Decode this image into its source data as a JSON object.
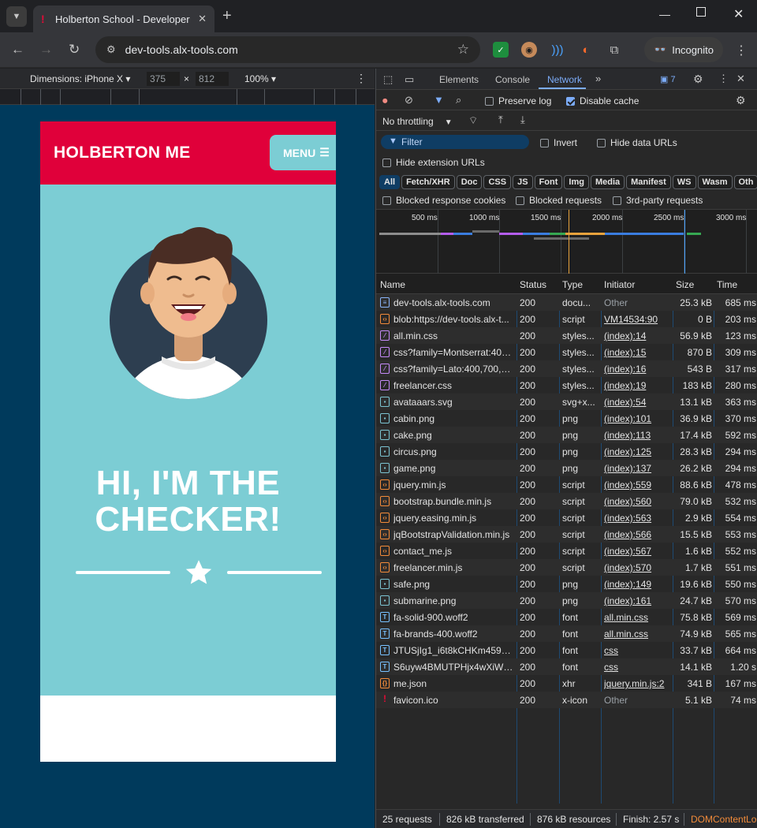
{
  "browser": {
    "tab_title": "Holberton School - Developer t",
    "url": "dev-tools.alx-tools.com",
    "incognito_label": "Incognito"
  },
  "device_toolbar": {
    "dimensions_label": "Dimensions: iPhone X",
    "width": "375",
    "height": "812",
    "times": "×",
    "zoom": "100%"
  },
  "site": {
    "brand": "HOLBERTON ME",
    "menu_label": "MENU",
    "hero_line1": "HI, I'M THE",
    "hero_line2": "CHECKER!"
  },
  "devtools": {
    "tabs": [
      "Elements",
      "Console",
      "Network"
    ],
    "active_tab": "Network",
    "issues_count": "7",
    "preserve_log": "Preserve log",
    "disable_cache": "Disable cache",
    "throttling": "No throttling",
    "filter_placeholder": "Filter",
    "invert": "Invert",
    "hide_data_urls": "Hide data URLs",
    "hide_extension_urls": "Hide extension URLs",
    "type_filters": [
      "All",
      "Fetch/XHR",
      "Doc",
      "CSS",
      "JS",
      "Font",
      "Img",
      "Media",
      "Manifest",
      "WS",
      "Wasm",
      "Oth"
    ],
    "blocked_response_cookies": "Blocked response cookies",
    "blocked_requests": "Blocked requests",
    "third_party_requests": "3rd-party requests",
    "timeline_labels": [
      "500 ms",
      "1000 ms",
      "1500 ms",
      "2000 ms",
      "2500 ms",
      "3000 ms"
    ],
    "columns": {
      "name": "Name",
      "status": "Status",
      "type": "Type",
      "initiator": "Initiator",
      "size": "Size",
      "time": "Time"
    },
    "requests": [
      {
        "name": "dev-tools.alx-tools.com",
        "status": "200",
        "type": "docu...",
        "initiator": "Other",
        "size": "25.3 kB",
        "time": "685 ms",
        "kind": "doc"
      },
      {
        "name": "blob:https://dev-tools.alx-t...",
        "status": "200",
        "type": "script",
        "initiator": "VM14534:90",
        "size": "0 B",
        "time": "203 ms",
        "kind": "js"
      },
      {
        "name": "all.min.css",
        "status": "200",
        "type": "styles...",
        "initiator": "(index):14",
        "size": "56.9 kB",
        "time": "123 ms",
        "kind": "css"
      },
      {
        "name": "css?family=Montserrat:400...",
        "status": "200",
        "type": "styles...",
        "initiator": "(index):15",
        "size": "870 B",
        "time": "309 ms",
        "kind": "css"
      },
      {
        "name": "css?family=Lato:400,700,4...",
        "status": "200",
        "type": "styles...",
        "initiator": "(index):16",
        "size": "543 B",
        "time": "317 ms",
        "kind": "css"
      },
      {
        "name": "freelancer.css",
        "status": "200",
        "type": "styles...",
        "initiator": "(index):19",
        "size": "183 kB",
        "time": "280 ms",
        "kind": "css"
      },
      {
        "name": "avataaars.svg",
        "status": "200",
        "type": "svg+x...",
        "initiator": "(index):54",
        "size": "13.1 kB",
        "time": "363 ms",
        "kind": "img"
      },
      {
        "name": "cabin.png",
        "status": "200",
        "type": "png",
        "initiator": "(index):101",
        "size": "36.9 kB",
        "time": "370 ms",
        "kind": "img"
      },
      {
        "name": "cake.png",
        "status": "200",
        "type": "png",
        "initiator": "(index):113",
        "size": "17.4 kB",
        "time": "592 ms",
        "kind": "img"
      },
      {
        "name": "circus.png",
        "status": "200",
        "type": "png",
        "initiator": "(index):125",
        "size": "28.3 kB",
        "time": "294 ms",
        "kind": "img"
      },
      {
        "name": "game.png",
        "status": "200",
        "type": "png",
        "initiator": "(index):137",
        "size": "26.2 kB",
        "time": "294 ms",
        "kind": "img"
      },
      {
        "name": "jquery.min.js",
        "status": "200",
        "type": "script",
        "initiator": "(index):559",
        "size": "88.6 kB",
        "time": "478 ms",
        "kind": "js"
      },
      {
        "name": "bootstrap.bundle.min.js",
        "status": "200",
        "type": "script",
        "initiator": "(index):560",
        "size": "79.0 kB",
        "time": "532 ms",
        "kind": "js"
      },
      {
        "name": "jquery.easing.min.js",
        "status": "200",
        "type": "script",
        "initiator": "(index):563",
        "size": "2.9 kB",
        "time": "554 ms",
        "kind": "js"
      },
      {
        "name": "jqBootstrapValidation.min.js",
        "status": "200",
        "type": "script",
        "initiator": "(index):566",
        "size": "15.5 kB",
        "time": "553 ms",
        "kind": "js"
      },
      {
        "name": "contact_me.js",
        "status": "200",
        "type": "script",
        "initiator": "(index):567",
        "size": "1.6 kB",
        "time": "552 ms",
        "kind": "js"
      },
      {
        "name": "freelancer.min.js",
        "status": "200",
        "type": "script",
        "initiator": "(index):570",
        "size": "1.7 kB",
        "time": "551 ms",
        "kind": "js"
      },
      {
        "name": "safe.png",
        "status": "200",
        "type": "png",
        "initiator": "(index):149",
        "size": "19.6 kB",
        "time": "550 ms",
        "kind": "img"
      },
      {
        "name": "submarine.png",
        "status": "200",
        "type": "png",
        "initiator": "(index):161",
        "size": "24.7 kB",
        "time": "570 ms",
        "kind": "img"
      },
      {
        "name": "fa-solid-900.woff2",
        "status": "200",
        "type": "font",
        "initiator": "all.min.css",
        "size": "75.8 kB",
        "time": "569 ms",
        "kind": "font"
      },
      {
        "name": "fa-brands-400.woff2",
        "status": "200",
        "type": "font",
        "initiator": "all.min.css",
        "size": "74.9 kB",
        "time": "565 ms",
        "kind": "font"
      },
      {
        "name": "JTUSjIg1_i6t8kCHKm459W...",
        "status": "200",
        "type": "font",
        "initiator": "css",
        "size": "33.7 kB",
        "time": "664 ms",
        "kind": "font"
      },
      {
        "name": "S6uyw4BMUTPHjx4wXiWt...",
        "status": "200",
        "type": "font",
        "initiator": "css",
        "size": "14.1 kB",
        "time": "1.20 s",
        "kind": "font"
      },
      {
        "name": "me.json",
        "status": "200",
        "type": "xhr",
        "initiator": "jquery.min.js:2",
        "size": "341 B",
        "time": "167 ms",
        "kind": "xhr"
      },
      {
        "name": "favicon.ico",
        "status": "200",
        "type": "x-icon",
        "initiator": "Other",
        "size": "5.1 kB",
        "time": "74 ms",
        "kind": "ico"
      }
    ],
    "status": {
      "requests": "25 requests",
      "transferred": "826 kB transferred",
      "resources": "876 kB resources",
      "finish": "Finish: 2.57 s",
      "dcl": "DOMContentLo"
    }
  }
}
